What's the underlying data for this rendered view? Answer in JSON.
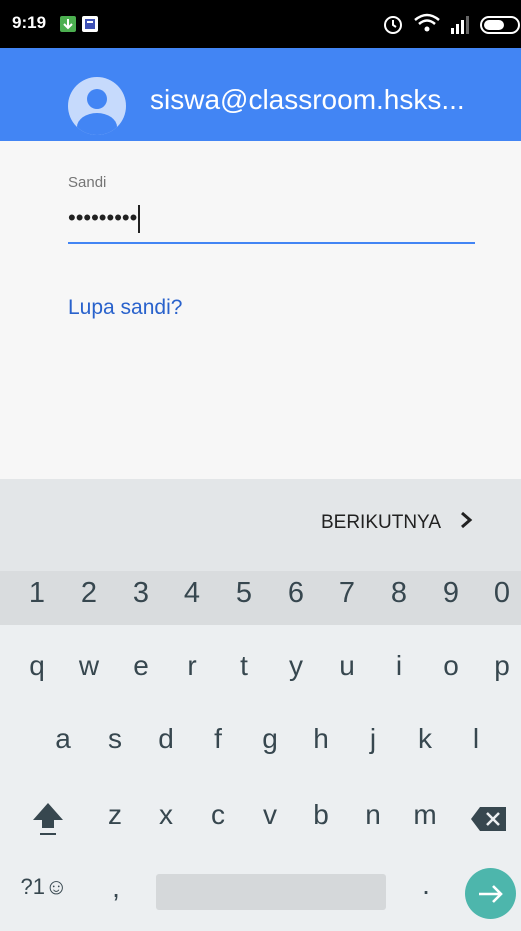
{
  "status_bar": {
    "time": "9:19",
    "icons": [
      "download-notification-icon",
      "app-notification-icon",
      "alarm-icon",
      "wifi-icon",
      "signal-icon",
      "battery-icon"
    ]
  },
  "account": {
    "email": "siswa@classroom.hsks..."
  },
  "password": {
    "label": "Sandi",
    "value": "•••••••••"
  },
  "forgot_link": "Lupa sandi?",
  "keyboard": {
    "next_label": "BERIKUTNYA",
    "numbers": [
      "1",
      "2",
      "3",
      "4",
      "5",
      "6",
      "7",
      "8",
      "9",
      "0"
    ],
    "row1": [
      "q",
      "w",
      "e",
      "r",
      "t",
      "y",
      "u",
      "i",
      "o",
      "p"
    ],
    "row2": [
      "a",
      "s",
      "d",
      "f",
      "g",
      "h",
      "j",
      "k",
      "l"
    ],
    "row3": [
      "z",
      "x",
      "c",
      "v",
      "b",
      "n",
      "m"
    ],
    "symbols_key": "?1☺",
    "comma_key": ",",
    "period_key": "."
  },
  "colors": {
    "header": "#4285f4",
    "link": "#2962cc",
    "enter_key": "#4db6ac"
  }
}
